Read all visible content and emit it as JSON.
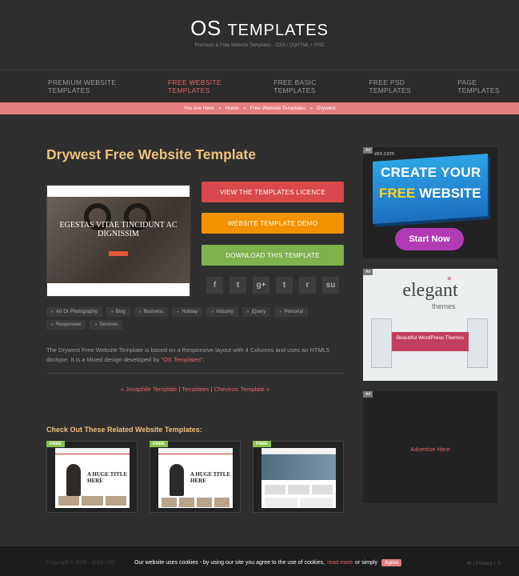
{
  "site": {
    "logo_first": "OS",
    "logo_second": "Templates",
    "tagline": "Premium & Free Website Templates - CSS / (X)HTML + PSD"
  },
  "nav": [
    "PREMIUM WEBSITE TEMPLATES",
    "FREE WEBSITE TEMPLATES",
    "FREE BASIC TEMPLATES",
    "FREE PSD TEMPLATES",
    "PAGE TEMPLATES"
  ],
  "breadcrumb": {
    "prefix": "You Are Here",
    "items": [
      "Home",
      "Free Website Templates",
      "Drywest"
    ]
  },
  "main": {
    "title": "Drywest Free Website Template",
    "preview_heading": "EGESTAS VITAE TINCIDUNT AC DIGNISSIM",
    "buttons": {
      "licence": "VIEW THE TEMPLATES LICENCE",
      "demo": "WEBSITE TEMPLATE DEMO",
      "download": "DOWNLOAD THIS TEMPLATE"
    },
    "socials": [
      "f",
      "t",
      "g+",
      "t",
      "r",
      "su"
    ],
    "tags": [
      "Art Or Photography",
      "Blog",
      "Business",
      "Holiday",
      "Industry",
      "jQuery",
      "Personal",
      "Responsive",
      "Services"
    ],
    "description": "The Drywest Free Website Template is based on a Responsive layout with 4 Columns and uses an HTML5 doctype. It is a Mixed design developed by \"",
    "description_link": "OS Templates",
    "description_end": "\".",
    "pager": {
      "prev": "« Jovaphile Template",
      "middle": "Templates",
      "next": "Chevesic Template »"
    },
    "related_title": "Check Out These Related Website Templates:",
    "free_badge": "FREE",
    "thumb_heading": "A HUGE TITLE HERE"
  },
  "ads": {
    "ad_label": "Ad",
    "ad1_mark": "wix.com",
    "ad1_line1": "CREATE YOUR",
    "ad1_line2_highlight": "FREE",
    "ad1_line2_rest": "WEBSITE",
    "ad1_cta": "Start Now",
    "ad2_brand": "elegant",
    "ad2_sub": "themes",
    "ad2_ribbon": "Beautiful WordPress Themes",
    "ad3_label": "Ad",
    "ad3_text": "Advertise Here"
  },
  "cookie": {
    "copyright": "Copyright © 2009 - 2018 - OS",
    "message": "Our website uses cookies - by using our site you agree to the use of cookies,",
    "read_more": "read more",
    "or": "or simply",
    "agree": "Agree",
    "right": "Privacy"
  }
}
